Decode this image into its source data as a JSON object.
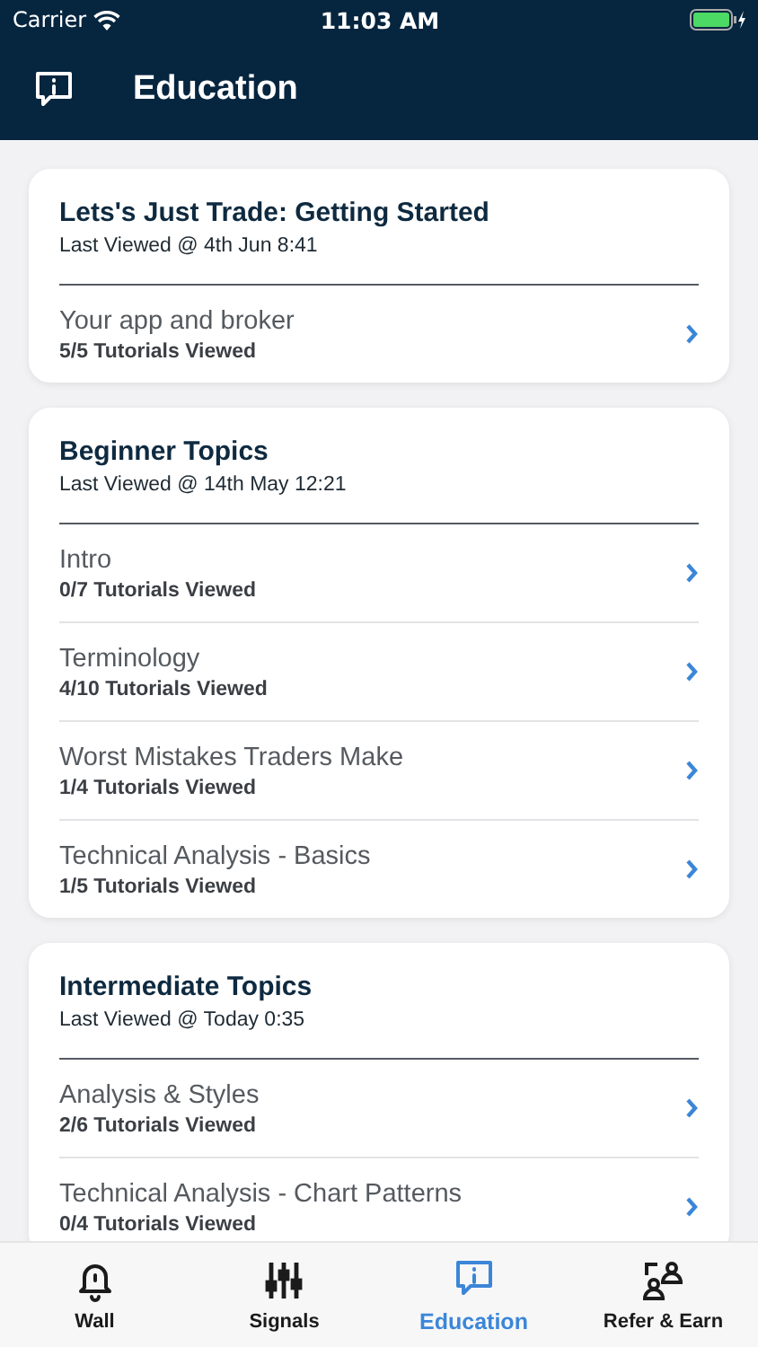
{
  "status_bar": {
    "carrier": "Carrier",
    "time": "11:03 AM"
  },
  "header": {
    "title": "Education"
  },
  "sections": [
    {
      "title": "Lets's Just Trade: Getting Started",
      "last_viewed": "Last Viewed @ 4th Jun 8:41",
      "items": [
        {
          "title": "Your app and broker",
          "progress": "5/5 Tutorials Viewed"
        }
      ]
    },
    {
      "title": "Beginner Topics",
      "last_viewed": "Last Viewed @ 14th May 12:21",
      "items": [
        {
          "title": "Intro",
          "progress": "0/7 Tutorials Viewed"
        },
        {
          "title": "Terminology",
          "progress": "4/10 Tutorials Viewed"
        },
        {
          "title": "Worst Mistakes Traders Make",
          "progress": "1/4 Tutorials Viewed"
        },
        {
          "title": "Technical Analysis - Basics",
          "progress": "1/5 Tutorials Viewed"
        }
      ]
    },
    {
      "title": "Intermediate Topics",
      "last_viewed": "Last Viewed @ Today 0:35",
      "items": [
        {
          "title": "Analysis & Styles",
          "progress": "2/6 Tutorials Viewed"
        },
        {
          "title": "Technical Analysis - Chart Patterns",
          "progress": "0/4 Tutorials Viewed"
        }
      ]
    }
  ],
  "tabs": [
    {
      "kind": "bell",
      "label": "Wall",
      "selected": false
    },
    {
      "kind": "sliders",
      "label": "Signals",
      "selected": false
    },
    {
      "kind": "info",
      "label": "Education",
      "selected": true
    },
    {
      "kind": "people",
      "label": "Refer & Earn",
      "selected": false
    }
  ]
}
